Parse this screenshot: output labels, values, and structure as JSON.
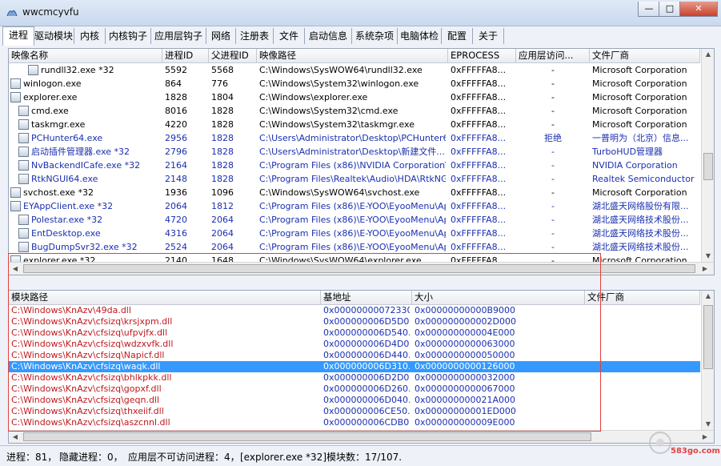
{
  "window": {
    "title": "wwcmcyvfu",
    "min": "—",
    "max": "□",
    "close": "✕"
  },
  "tabs": [
    "进程",
    "驱动模块",
    "内核",
    "内核钩子",
    "应用层钩子",
    "网络",
    "注册表",
    "文件",
    "启动信息",
    "系统杂项",
    "电脑体检",
    "配置",
    "关于"
  ],
  "proc_headers": [
    "映像名称",
    "进程ID",
    "父进程ID",
    "映像路径",
    "EPROCESS",
    "应用层访问...",
    "文件厂商"
  ],
  "processes": [
    {
      "name": "rundll32.exe *32",
      "pid": "5592",
      "ppid": "5568",
      "path": "C:\\Windows\\SysWOW64\\rundll32.exe",
      "ep": "0xFFFFFA8...",
      "access": "-",
      "vendor": "Microsoft Corporation",
      "indent": 3,
      "color": "#000000",
      "icon": "file-icon"
    },
    {
      "name": "winlogon.exe",
      "pid": "864",
      "ppid": "776",
      "path": "C:\\Windows\\System32\\winlogon.exe",
      "ep": "0xFFFFFA8...",
      "access": "-",
      "vendor": "Microsoft Corporation",
      "indent": 1,
      "color": "#000000",
      "icon": "winlogon-icon"
    },
    {
      "name": "explorer.exe",
      "pid": "1828",
      "ppid": "1804",
      "path": "C:\\Windows\\explorer.exe",
      "ep": "0xFFFFFA8...",
      "access": "-",
      "vendor": "Microsoft Corporation",
      "indent": 1,
      "color": "#000000",
      "icon": "folder-icon"
    },
    {
      "name": "cmd.exe",
      "pid": "8016",
      "ppid": "1828",
      "path": "C:\\Windows\\System32\\cmd.exe",
      "ep": "0xFFFFFA8...",
      "access": "-",
      "vendor": "Microsoft Corporation",
      "indent": 2,
      "color": "#000000",
      "icon": "cmd-icon"
    },
    {
      "name": "taskmgr.exe",
      "pid": "4220",
      "ppid": "1828",
      "path": "C:\\Windows\\System32\\taskmgr.exe",
      "ep": "0xFFFFFA8...",
      "access": "-",
      "vendor": "Microsoft Corporation",
      "indent": 2,
      "color": "#000000",
      "icon": "taskmgr-icon"
    },
    {
      "name": "PCHunter64.exe",
      "pid": "2956",
      "ppid": "1828",
      "path": "C:\\Users\\Administrator\\Desktop\\PCHunter64....",
      "ep": "0xFFFFFA8...",
      "access": "拒绝",
      "vendor": "一普明为（北京）信息...",
      "indent": 2,
      "color": "#1a2fb0",
      "icon": "pchunter-icon"
    },
    {
      "name": "启动插件管理器.exe *32",
      "pid": "2796",
      "ppid": "1828",
      "path": "C:\\Users\\Administrator\\Desktop\\新建文件...",
      "ep": "0xFFFFFA8...",
      "access": "-",
      "vendor": "TurboHUD管理器",
      "indent": 2,
      "color": "#1a2fb0",
      "icon": "gear-icon"
    },
    {
      "name": "NvBackendICafe.exe *32",
      "pid": "2164",
      "ppid": "1828",
      "path": "C:\\Program Files (x86)\\NVIDIA Corporation\\...",
      "ep": "0xFFFFFA8...",
      "access": "-",
      "vendor": "NVIDIA Corporation",
      "indent": 2,
      "color": "#1a2fb0",
      "icon": "nvidia-icon"
    },
    {
      "name": "RtkNGUI64.exe",
      "pid": "2148",
      "ppid": "1828",
      "path": "C:\\Program Files\\Realtek\\Audio\\HDA\\RtkNGU...",
      "ep": "0xFFFFFA8...",
      "access": "-",
      "vendor": "Realtek Semiconductor",
      "indent": 2,
      "color": "#1a2fb0",
      "icon": "realtek-icon"
    },
    {
      "name": "svchost.exe *32",
      "pid": "1936",
      "ppid": "1096",
      "path": "C:\\Windows\\SysWOW64\\svchost.exe",
      "ep": "0xFFFFFA8...",
      "access": "-",
      "vendor": "Microsoft Corporation",
      "indent": 1,
      "color": "#000000",
      "icon": "svchost-icon"
    },
    {
      "name": "EYAppClient.exe *32",
      "pid": "2064",
      "ppid": "1812",
      "path": "C:\\Program Files (x86)\\E-YOO\\EyooMenu\\Ap...",
      "ep": "0xFFFFFA8...",
      "access": "-",
      "vendor": "湖北盛天网络股份有限...",
      "indent": 1,
      "color": "#1a2fb0",
      "icon": "app-icon"
    },
    {
      "name": "Polestar.exe *32",
      "pid": "4720",
      "ppid": "2064",
      "path": "C:\\Program Files (x86)\\E-YOO\\EyooMenu\\Ap...",
      "ep": "0xFFFFFA8...",
      "access": "-",
      "vendor": "湖北盛天网络技术股份...",
      "indent": 2,
      "color": "#1a2fb0",
      "icon": "app-icon"
    },
    {
      "name": "EntDesktop.exe",
      "pid": "4316",
      "ppid": "2064",
      "path": "C:\\Program Files (x86)\\E-YOO\\EyooMenu\\Ap...",
      "ep": "0xFFFFFA8...",
      "access": "-",
      "vendor": "湖北盛天网络技术股份...",
      "indent": 2,
      "color": "#1a2fb0",
      "icon": "desktop-icon"
    },
    {
      "name": "BugDumpSvr32.exe *32",
      "pid": "2524",
      "ppid": "2064",
      "path": "C:\\Program Files (x86)\\E-YOO\\EyooMenu\\Ap...",
      "ep": "0xFFFFFA8...",
      "access": "-",
      "vendor": "湖北盛天网络技术股份...",
      "indent": 2,
      "color": "#1a2fb0",
      "icon": "app-icon"
    },
    {
      "name": "explorer.exe *32",
      "pid": "2140",
      "ppid": "1648",
      "path": "C:\\Windows\\SysWOW64\\explorer.exe",
      "ep": "0xFFFFFA8...",
      "access": "-",
      "vendor": "Microsoft Corporation",
      "indent": 1,
      "color": "#000000",
      "icon": "folder-icon"
    }
  ],
  "mod_headers": [
    "模块路径",
    "基地址",
    "大小",
    "文件厂商"
  ],
  "modules": [
    {
      "path": "C:\\Windows\\KnAzv\\49da.dll",
      "base": "0x00000000072330...",
      "size": "0x00000000000B9000",
      "vendor": ""
    },
    {
      "path": "C:\\Windows\\KnAzv\\cfsizq\\krsjxpm.dll",
      "base": "0x000000006D5D0...",
      "size": "0x000000000002D000",
      "vendor": ""
    },
    {
      "path": "C:\\Windows\\KnAzv\\cfsizq\\ufpvjfx.dll",
      "base": "0x000000006D540...",
      "size": "0x000000000004E000",
      "vendor": ""
    },
    {
      "path": "C:\\Windows\\KnAzv\\cfsizq\\wdzxvfk.dll",
      "base": "0x000000006D4D0...",
      "size": "0x0000000000063000",
      "vendor": ""
    },
    {
      "path": "C:\\Windows\\KnAzv\\cfsizq\\Napicf.dll",
      "base": "0x000000006D440...",
      "size": "0x0000000000050000",
      "vendor": ""
    },
    {
      "path": "C:\\Windows\\KnAzv\\cfsizq\\waqk.dll",
      "base": "0x000000006D310...",
      "size": "0x0000000000126000",
      "vendor": ""
    },
    {
      "path": "C:\\Windows\\KnAzv\\cfsizq\\bhlkpkk.dll",
      "base": "0x000000006D2D0...",
      "size": "0x0000000000032000",
      "vendor": ""
    },
    {
      "path": "C:\\Windows\\KnAzv\\cfsizq\\gopxf.dll",
      "base": "0x000000006D260...",
      "size": "0x0000000000067000",
      "vendor": ""
    },
    {
      "path": "C:\\Windows\\KnAzv\\cfsizq\\geqn.dll",
      "base": "0x000000006D040...",
      "size": "0x000000000021A000",
      "vendor": ""
    },
    {
      "path": "C:\\Windows\\KnAzv\\cfsizq\\thxeiif.dll",
      "base": "0x000000006CE50...",
      "size": "0x00000000001ED000",
      "vendor": ""
    },
    {
      "path": "C:\\Windows\\KnAzv\\cfsizq\\aszcnnl.dll",
      "base": "0x000000006CDB0...",
      "size": "0x000000000009E000",
      "vendor": ""
    }
  ],
  "selected_module": 5,
  "status": {
    "processes": "进程：81，",
    "hidden": "隐藏进程：0，",
    "inaccessible": "应用层不可访问进程：4，",
    "modules": "[explorer.exe *32]模块数：17/107."
  },
  "watermark": {
    "text": "583go.com"
  },
  "colors": {
    "accent_blue": "#1a2fb0",
    "module_red": "#c0181d",
    "selection": "#3399ff",
    "red_box": "#e04040"
  }
}
